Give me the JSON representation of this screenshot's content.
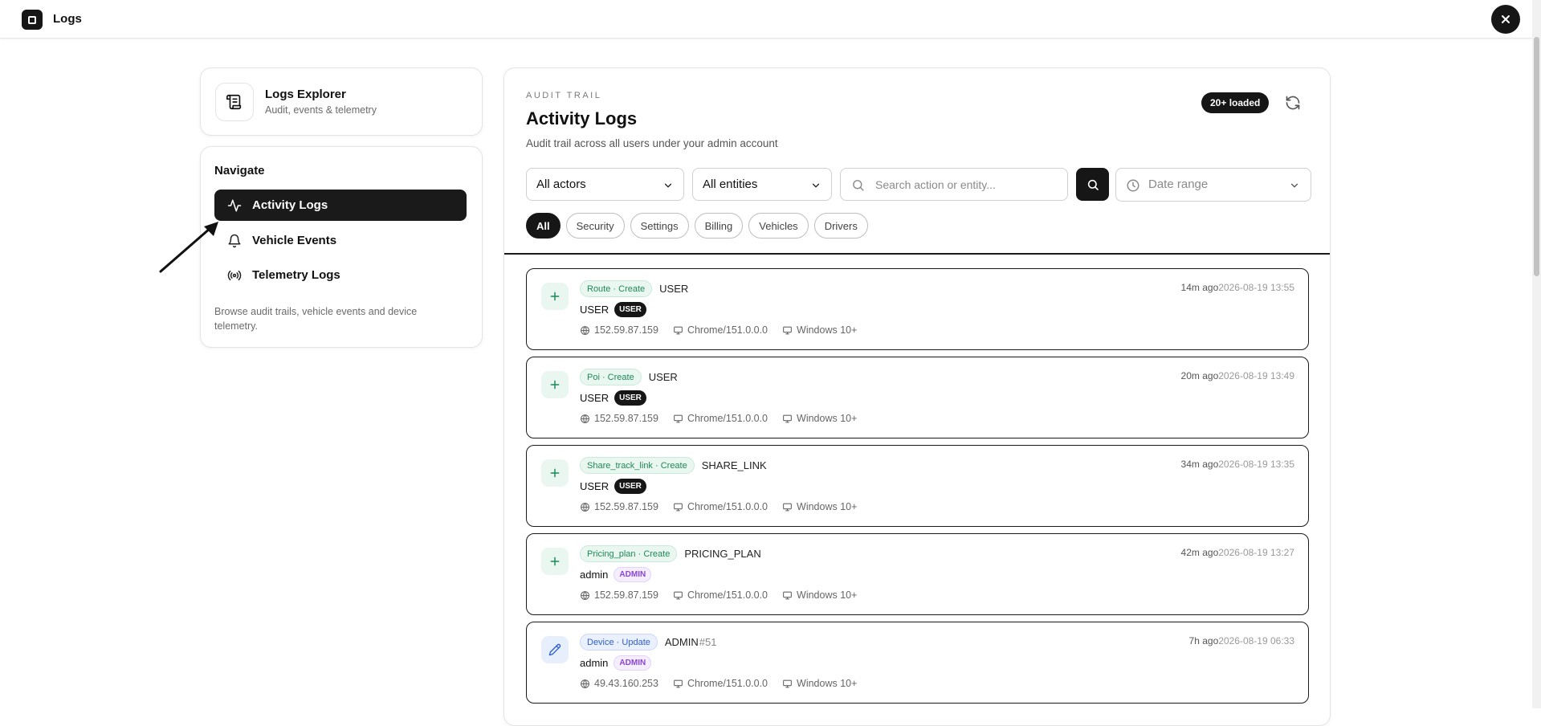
{
  "app": {
    "title": "Logs"
  },
  "sidebar": {
    "explorer": {
      "title": "Logs Explorer",
      "subtitle": "Audit, events & telemetry"
    },
    "nav_heading": "Navigate",
    "items": [
      {
        "label": "Activity Logs",
        "icon": "activity-icon",
        "active": true
      },
      {
        "label": "Vehicle Events",
        "icon": "bell-icon",
        "active": false
      },
      {
        "label": "Telemetry Logs",
        "icon": "broadcast-icon",
        "active": false
      }
    ],
    "footer": "Browse audit trails, vehicle events and device telemetry."
  },
  "main": {
    "eyebrow": "AUDIT TRAIL",
    "title": "Activity Logs",
    "subtitle": "Audit trail across all users under your admin account",
    "loaded_badge": "20+ loaded",
    "filters": {
      "actors": "All actors",
      "entities": "All entities",
      "search_placeholder": "Search action or entity...",
      "date_range": "Date range"
    },
    "chips": [
      "All",
      "Security",
      "Settings",
      "Billing",
      "Vehicles",
      "Drivers"
    ],
    "logs": [
      {
        "op": "create",
        "action": "Route · Create",
        "entity": "USER",
        "entity_id": "",
        "actor": "USER",
        "role": "USER",
        "role_type": "user",
        "ip": "152.59.87.159",
        "browser": "Chrome/151.0.0.0",
        "os": "Windows 10+",
        "rel_time": "14m ago",
        "abs_time": "2026-08-19 13:55"
      },
      {
        "op": "create",
        "action": "Poi · Create",
        "entity": "USER",
        "entity_id": "",
        "actor": "USER",
        "role": "USER",
        "role_type": "user",
        "ip": "152.59.87.159",
        "browser": "Chrome/151.0.0.0",
        "os": "Windows 10+",
        "rel_time": "20m ago",
        "abs_time": "2026-08-19 13:49"
      },
      {
        "op": "create",
        "action": "Share_track_link · Create",
        "entity": "SHARE_LINK",
        "entity_id": "",
        "actor": "USER",
        "role": "USER",
        "role_type": "user",
        "ip": "152.59.87.159",
        "browser": "Chrome/151.0.0.0",
        "os": "Windows 10+",
        "rel_time": "34m ago",
        "abs_time": "2026-08-19 13:35"
      },
      {
        "op": "create",
        "action": "Pricing_plan · Create",
        "entity": "PRICING_PLAN",
        "entity_id": "",
        "actor": "admin",
        "role": "ADMIN",
        "role_type": "admin",
        "ip": "152.59.87.159",
        "browser": "Chrome/151.0.0.0",
        "os": "Windows 10+",
        "rel_time": "42m ago",
        "abs_time": "2026-08-19 13:27"
      },
      {
        "op": "update",
        "action": "Device · Update",
        "entity": "ADMIN",
        "entity_id": "#51",
        "actor": "admin",
        "role": "ADMIN",
        "role_type": "admin",
        "ip": "49.43.160.253",
        "browser": "Chrome/151.0.0.0",
        "os": "Windows 10+",
        "rel_time": "7h ago",
        "abs_time": "2026-08-19 06:33"
      }
    ]
  }
}
